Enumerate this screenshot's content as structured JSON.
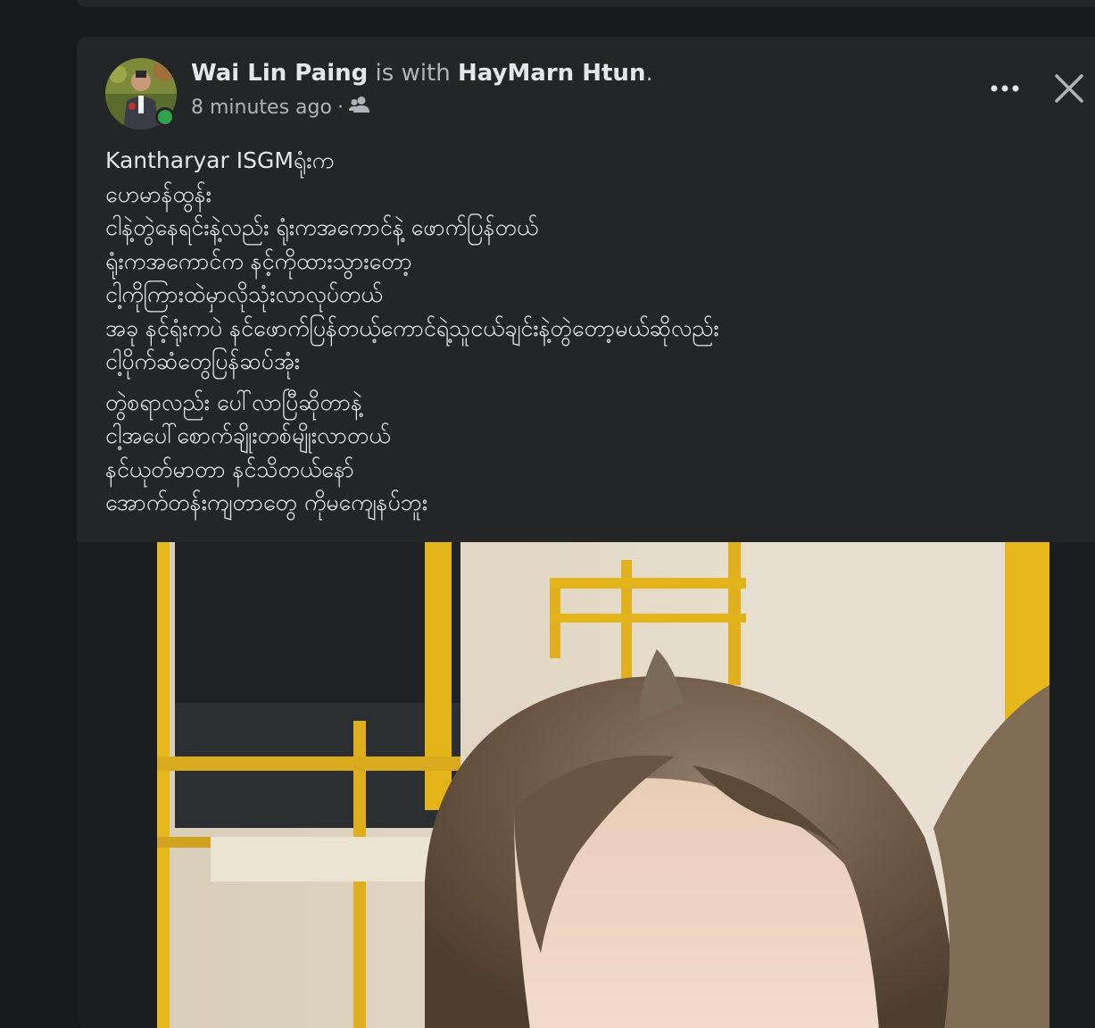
{
  "post": {
    "author": "Wai Lin Paing",
    "with_text": "is with",
    "tagged": "HayMarn Htun",
    "period": ".",
    "time": "8 minutes ago",
    "dot": "·",
    "audience_icon": "friends-icon",
    "text_block_1": [
      "Kantharyar ISGMရုံးက",
      "ဟေမာန်ထွန်း",
      "ငါနဲ့တွဲနေရင်းနဲ့လည်း ရုံးကအကောင်နဲ့ ဖောက်ပြန်တယ်",
      "ရုံးကအကောင်က နင့်ကိုထားသွားတော့",
      "ငါ့ကိုကြားထဲမှာလိုသုံးလာလုပ်တယ်",
      "အခု နင့်ရုံးကပဲ နင်ဖောက်ပြန်တယ့်ကောင်ရဲ့သူငယ်ချင်းနဲ့တွဲတော့မယ်ဆိုလည်း",
      "ငါ့ပိုက်ဆံတွေပြန်ဆပ်အုံး"
    ],
    "text_block_2": [
      "တွဲစရာလည်း ပေါ်လာပြီဆိုတာနဲ့",
      "ငါ့အပေါ်စောက်ချိုးတစ်မျိုးလာတယ်",
      "နင်ယုတ်မာတာ နင်သိတယ်နော်",
      "အောက်တန်းကျတာတွေ ကိုမကျေနပ်ဘူး"
    ]
  },
  "colors": {
    "page_bg": "#18191a",
    "card_bg": "#242526",
    "primary_text": "#e4e6eb",
    "secondary_text": "#b0b3b8",
    "online": "#31a24c"
  }
}
